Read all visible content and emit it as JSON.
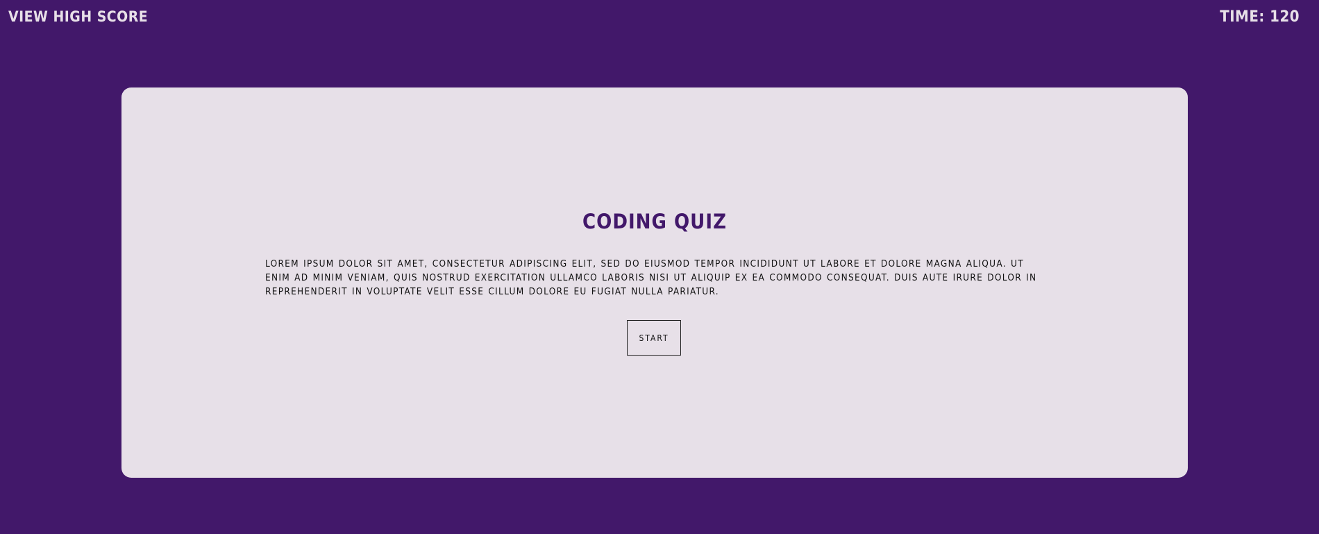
{
  "header": {
    "high_score_label": "VIEW HIGH SCORE",
    "timer_label": "TIME: 120"
  },
  "quiz": {
    "title": "CODING QUIZ",
    "description": "LOREM IPSUM DOLOR SIT AMET, CONSECTETUR ADIPISCING ELIT, SED DO EIUSMOD TEMPOR INCIDIDUNT UT LABORE ET DOLORE MAGNA ALIQUA. UT ENIM AD MINIM VENIAM, QUIS NOSTRUD EXERCITATION ULLAMCO LABORIS NISI UT ALIQUIP EX EA COMMODO CONSEQUAT. DUIS AUTE IRURE DOLOR IN REPREHENDERIT IN VOLUPTATE VELIT ESSE CILLUM DOLORE EU FUGIAT NULLA PARIATUR.",
    "start_label": "START"
  },
  "colors": {
    "background": "#42186a",
    "card": "#e7e0e8",
    "accent_text": "#42186a",
    "header_text": "#e8e0e8"
  }
}
